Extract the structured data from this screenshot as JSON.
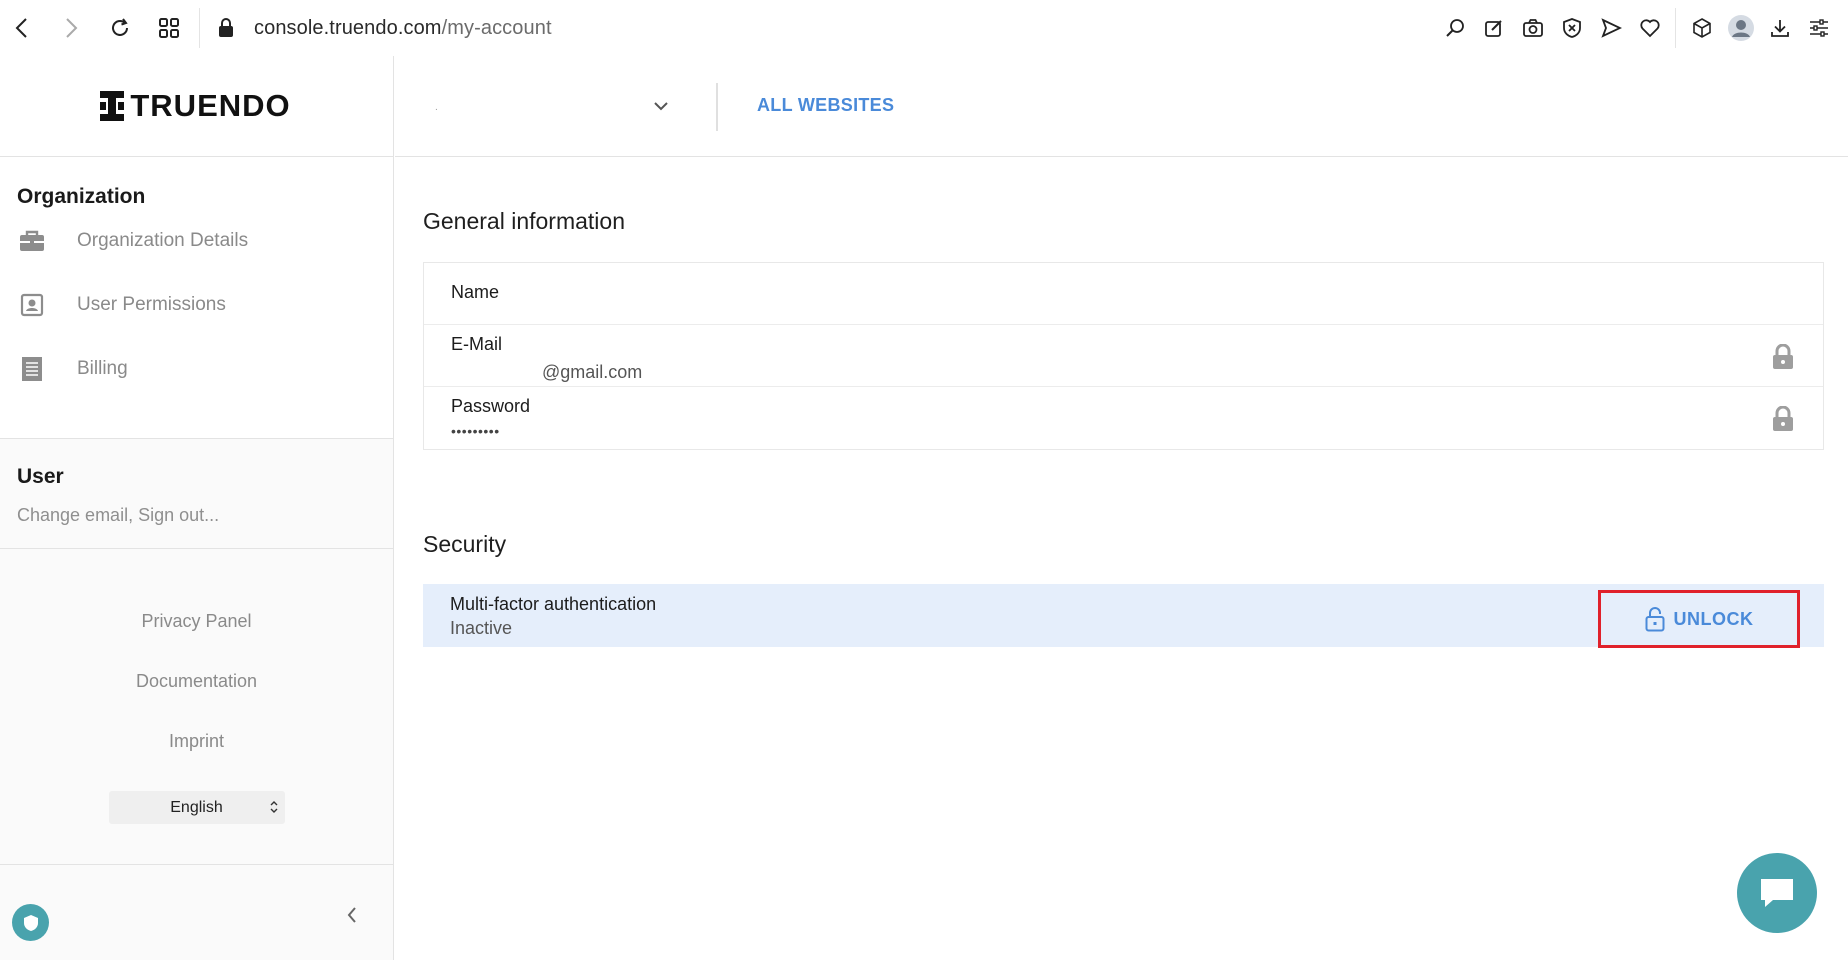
{
  "browser": {
    "url_host": "console.truendo.com",
    "url_path": "/my-account",
    "icons": [
      "back-icon",
      "forward-icon",
      "reload-icon",
      "speed-dial-icon",
      "lock-icon",
      "search-icon",
      "edit-icon",
      "camera-icon",
      "shield-x-icon",
      "send-icon",
      "heart-icon",
      "cube-icon",
      "profile-icon",
      "download-icon",
      "settings-icon"
    ]
  },
  "logo": {
    "text": "TRUENDO"
  },
  "sidebar": {
    "organization_title": "Organization",
    "menu": [
      {
        "label": "Organization Details",
        "icon": "briefcase-icon"
      },
      {
        "label": "User Permissions",
        "icon": "user-box-icon"
      },
      {
        "label": "Billing",
        "icon": "receipt-icon"
      }
    ],
    "user_title": "User",
    "user_subtitle": "Change email, Sign out...",
    "footer_links": [
      "Privacy Panel",
      "Documentation",
      "Imprint"
    ],
    "language": "English"
  },
  "topbar": {
    "site_select_value": ".",
    "all_websites": "ALL WEBSITES"
  },
  "general": {
    "title": "General information",
    "name_label": "Name",
    "email_label": "E-Mail",
    "email_value": "@gmail.com",
    "password_label": "Password",
    "password_value": "•••••••••"
  },
  "security": {
    "title": "Security",
    "mfa_label": "Multi-factor authentication",
    "mfa_status": "Inactive",
    "unlock_label": "UNLOCK"
  },
  "colors": {
    "accent": "#4a8ad9",
    "teal": "#49a3ad",
    "highlight_border": "#e0212b",
    "mfa_bg": "#e5eefb"
  }
}
